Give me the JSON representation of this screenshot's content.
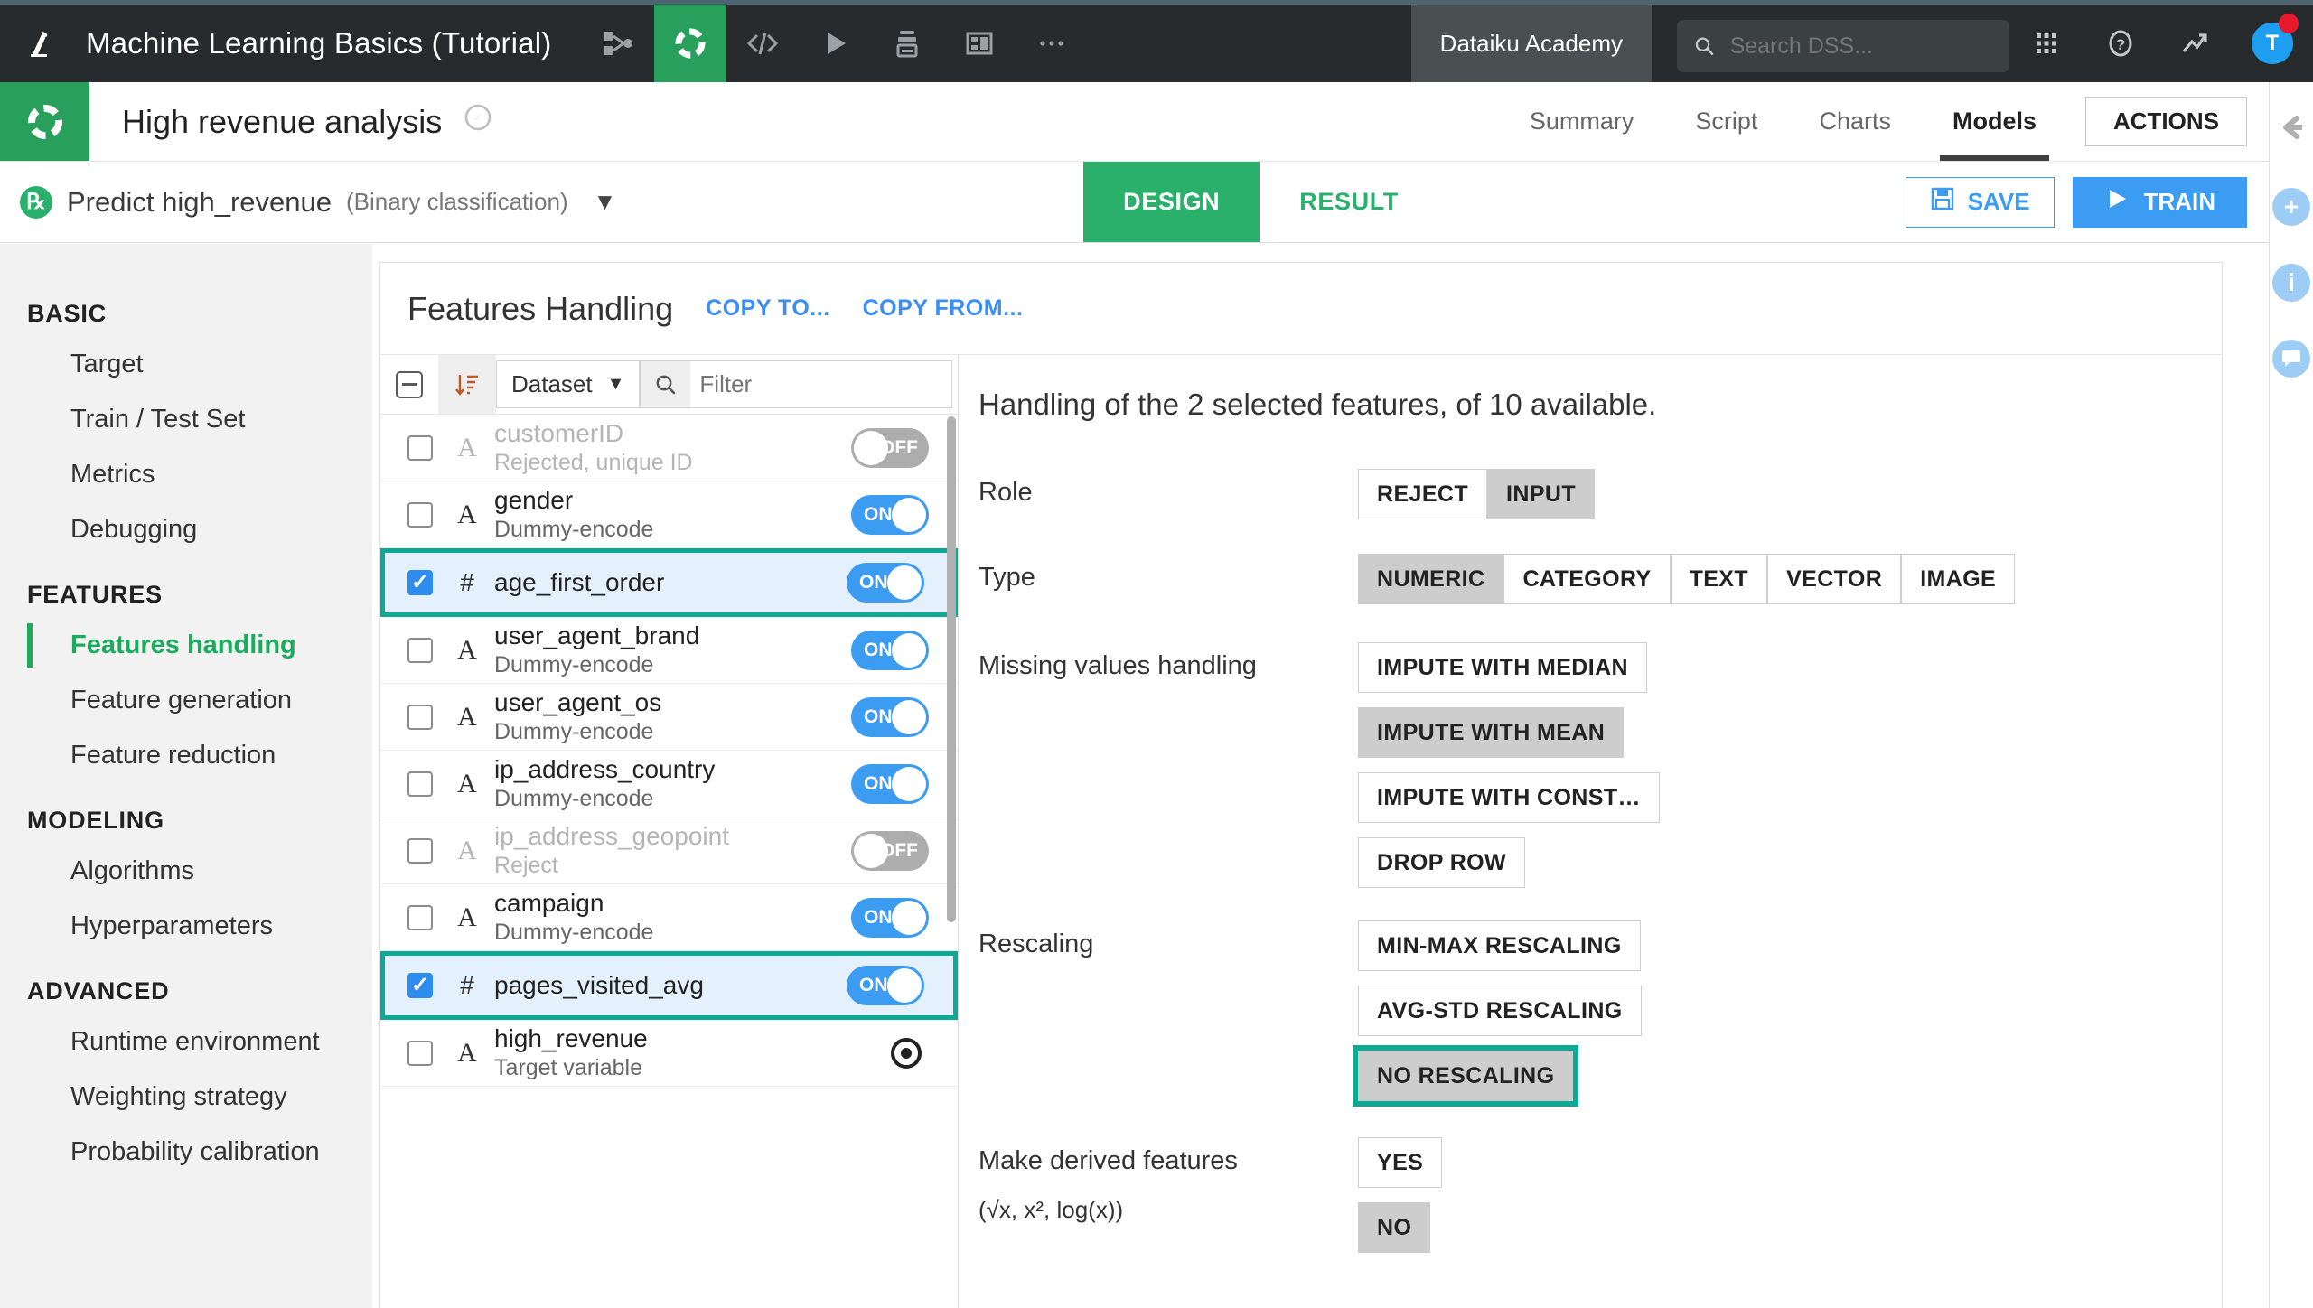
{
  "topbar": {
    "project_title": "Machine Learning Basics (Tutorial)",
    "icons": [
      "flow-icon",
      "lab-icon",
      "code-icon",
      "run-icon",
      "jobs-icon",
      "dashboard-icon",
      "more-icon"
    ],
    "academy_label": "Dataiku Academy",
    "search_placeholder": "Search DSS...",
    "right_icons": [
      "apps-grid-icon",
      "help-icon",
      "activity-icon"
    ],
    "avatar_initial": "T",
    "notification_color": "#e8192c",
    "accent_color": "#28a05c"
  },
  "secondbar": {
    "analysis_title": "High revenue analysis",
    "compass_icon": "compass-icon",
    "tabs": [
      {
        "label": "Summary",
        "active": false
      },
      {
        "label": "Script",
        "active": false
      },
      {
        "label": "Charts",
        "active": false
      },
      {
        "label": "Models",
        "active": true
      }
    ],
    "actions_label": "ACTIONS"
  },
  "thirdbar": {
    "model_name": "Predict high_revenue",
    "model_type": "(Binary classification)",
    "python_icon": "python-icon",
    "caret": "▼",
    "segments": [
      {
        "label": "DESIGN",
        "active": true
      },
      {
        "label": "RESULT",
        "active": false
      }
    ],
    "save_label": "SAVE",
    "train_label": "TRAIN",
    "save_icon": "floppy-disk-icon",
    "train_icon": "play-icon",
    "primary_color": "#3b9cf2"
  },
  "sidebar": {
    "groups": [
      {
        "title": "BASIC",
        "items": [
          {
            "label": "Target",
            "active": false
          },
          {
            "label": "Train / Test Set",
            "active": false
          },
          {
            "label": "Metrics",
            "active": false
          },
          {
            "label": "Debugging",
            "active": false
          }
        ]
      },
      {
        "title": "FEATURES",
        "items": [
          {
            "label": "Features handling",
            "active": true
          },
          {
            "label": "Feature generation",
            "active": false
          },
          {
            "label": "Feature reduction",
            "active": false
          }
        ]
      },
      {
        "title": "MODELING",
        "items": [
          {
            "label": "Algorithms",
            "active": false
          },
          {
            "label": "Hyperparameters",
            "active": false
          }
        ]
      },
      {
        "title": "ADVANCED",
        "items": [
          {
            "label": "Runtime environment",
            "active": false
          },
          {
            "label": "Weighting strategy",
            "active": false
          },
          {
            "label": "Probability calibration",
            "active": false
          }
        ]
      }
    ]
  },
  "panel": {
    "title": "Features Handling",
    "copy_to_label": "COPY TO...",
    "copy_from_label": "COPY FROM...",
    "toolbar": {
      "collapse_icon": "collapse-all-icon",
      "sort_icon": "sort-icon",
      "select_value": "Dataset",
      "select_caret": "▼",
      "search_icon": "search-icon",
      "filter_placeholder": "Filter",
      "filter_value": ""
    },
    "features": [
      {
        "name": "customerID",
        "desc": "Rejected, unique ID",
        "type": "A",
        "type_kind": "text",
        "checked": false,
        "toggle": "OFF",
        "dim": true,
        "selected": false
      },
      {
        "name": "gender",
        "desc": "Dummy-encode",
        "type": "A",
        "type_kind": "text",
        "checked": false,
        "toggle": "ON",
        "dim": false,
        "selected": false
      },
      {
        "name": "age_first_order",
        "desc": "",
        "type": "#",
        "type_kind": "num",
        "checked": true,
        "toggle": "ON",
        "dim": false,
        "selected": true
      },
      {
        "name": "user_agent_brand",
        "desc": "Dummy-encode",
        "type": "A",
        "type_kind": "text",
        "checked": false,
        "toggle": "ON",
        "dim": false,
        "selected": false
      },
      {
        "name": "user_agent_os",
        "desc": "Dummy-encode",
        "type": "A",
        "type_kind": "text",
        "checked": false,
        "toggle": "ON",
        "dim": false,
        "selected": false
      },
      {
        "name": "ip_address_country",
        "desc": "Dummy-encode",
        "type": "A",
        "type_kind": "text",
        "checked": false,
        "toggle": "ON",
        "dim": false,
        "selected": false
      },
      {
        "name": "ip_address_geopoint",
        "desc": "Reject",
        "type": "A",
        "type_kind": "text",
        "checked": false,
        "toggle": "OFF",
        "dim": true,
        "selected": false
      },
      {
        "name": "campaign",
        "desc": "Dummy-encode",
        "type": "A",
        "type_kind": "text",
        "checked": false,
        "toggle": "ON",
        "dim": false,
        "selected": false
      },
      {
        "name": "pages_visited_avg",
        "desc": "",
        "type": "#",
        "type_kind": "num",
        "checked": true,
        "toggle": "ON",
        "dim": false,
        "selected": true
      },
      {
        "name": "high_revenue",
        "desc": "Target variable",
        "type": "A",
        "type_kind": "text",
        "checked": false,
        "toggle": "TARGET",
        "dim": false,
        "selected": false
      }
    ],
    "detail": {
      "heading": "Handling of the 2 selected features, of 10 available.",
      "selected_count": 2,
      "available_count": 10,
      "settings": [
        {
          "label": "Role",
          "sublabel": "",
          "layout": "inline",
          "options": [
            {
              "label": "REJECT",
              "active": false,
              "highlighted": false
            },
            {
              "label": "INPUT",
              "active": true,
              "highlighted": false
            }
          ]
        },
        {
          "label": "Type",
          "sublabel": "",
          "layout": "inline",
          "options": [
            {
              "label": "NUMERIC",
              "active": true,
              "highlighted": false
            },
            {
              "label": "CATEGORY",
              "active": false,
              "highlighted": false
            },
            {
              "label": "TEXT",
              "active": false,
              "highlighted": false
            },
            {
              "label": "VECTOR",
              "active": false,
              "highlighted": false
            },
            {
              "label": "IMAGE",
              "active": false,
              "highlighted": false
            }
          ]
        },
        {
          "label": "Missing values handling",
          "sublabel": "",
          "layout": "stack",
          "options": [
            {
              "label": "IMPUTE WITH MEDIAN",
              "active": false,
              "highlighted": false
            },
            {
              "label": "IMPUTE WITH MEAN",
              "active": true,
              "highlighted": false
            },
            {
              "label": "IMPUTE WITH CONST…",
              "active": false,
              "highlighted": false
            },
            {
              "label": "DROP ROW",
              "active": false,
              "highlighted": false
            }
          ]
        },
        {
          "label": "Rescaling",
          "sublabel": "",
          "layout": "stack",
          "options": [
            {
              "label": "MIN-MAX RESCALING",
              "active": false,
              "highlighted": false
            },
            {
              "label": "AVG-STD RESCALING",
              "active": false,
              "highlighted": false
            },
            {
              "label": "NO RESCALING",
              "active": true,
              "highlighted": true
            }
          ]
        },
        {
          "label": "Make derived features",
          "sublabel": "(√x, x², log(x))",
          "layout": "stack",
          "options": [
            {
              "label": "YES",
              "active": false,
              "highlighted": false
            },
            {
              "label": "NO",
              "active": true,
              "highlighted": false
            }
          ]
        }
      ]
    }
  },
  "rightrail": {
    "items": [
      {
        "icon": "back-arrow-icon",
        "kind": "arrow"
      },
      {
        "icon": "plus-icon",
        "kind": "circle",
        "glyph": "+"
      },
      {
        "icon": "info-icon",
        "kind": "circle",
        "glyph": "i"
      },
      {
        "icon": "comment-icon",
        "kind": "circle",
        "glyph": "💬"
      }
    ],
    "highlight_color": "#0caa96"
  }
}
